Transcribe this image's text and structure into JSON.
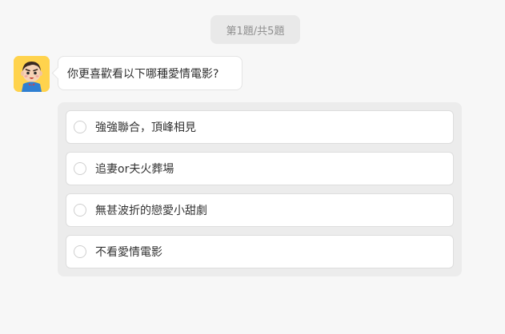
{
  "progress": {
    "label": "第1題/共5題"
  },
  "avatar": {
    "icon": "cartoon-boy-avatar-icon",
    "background": "#ffd34d"
  },
  "question": {
    "text": "你更喜歡看以下哪種愛情電影?"
  },
  "options": [
    {
      "label": "強強聯合，頂峰相見",
      "selected": false
    },
    {
      "label": "追妻or夫火葬場",
      "selected": false
    },
    {
      "label": "無甚波折的戀愛小甜劇",
      "selected": false
    },
    {
      "label": "不看愛情電影",
      "selected": false
    }
  ]
}
